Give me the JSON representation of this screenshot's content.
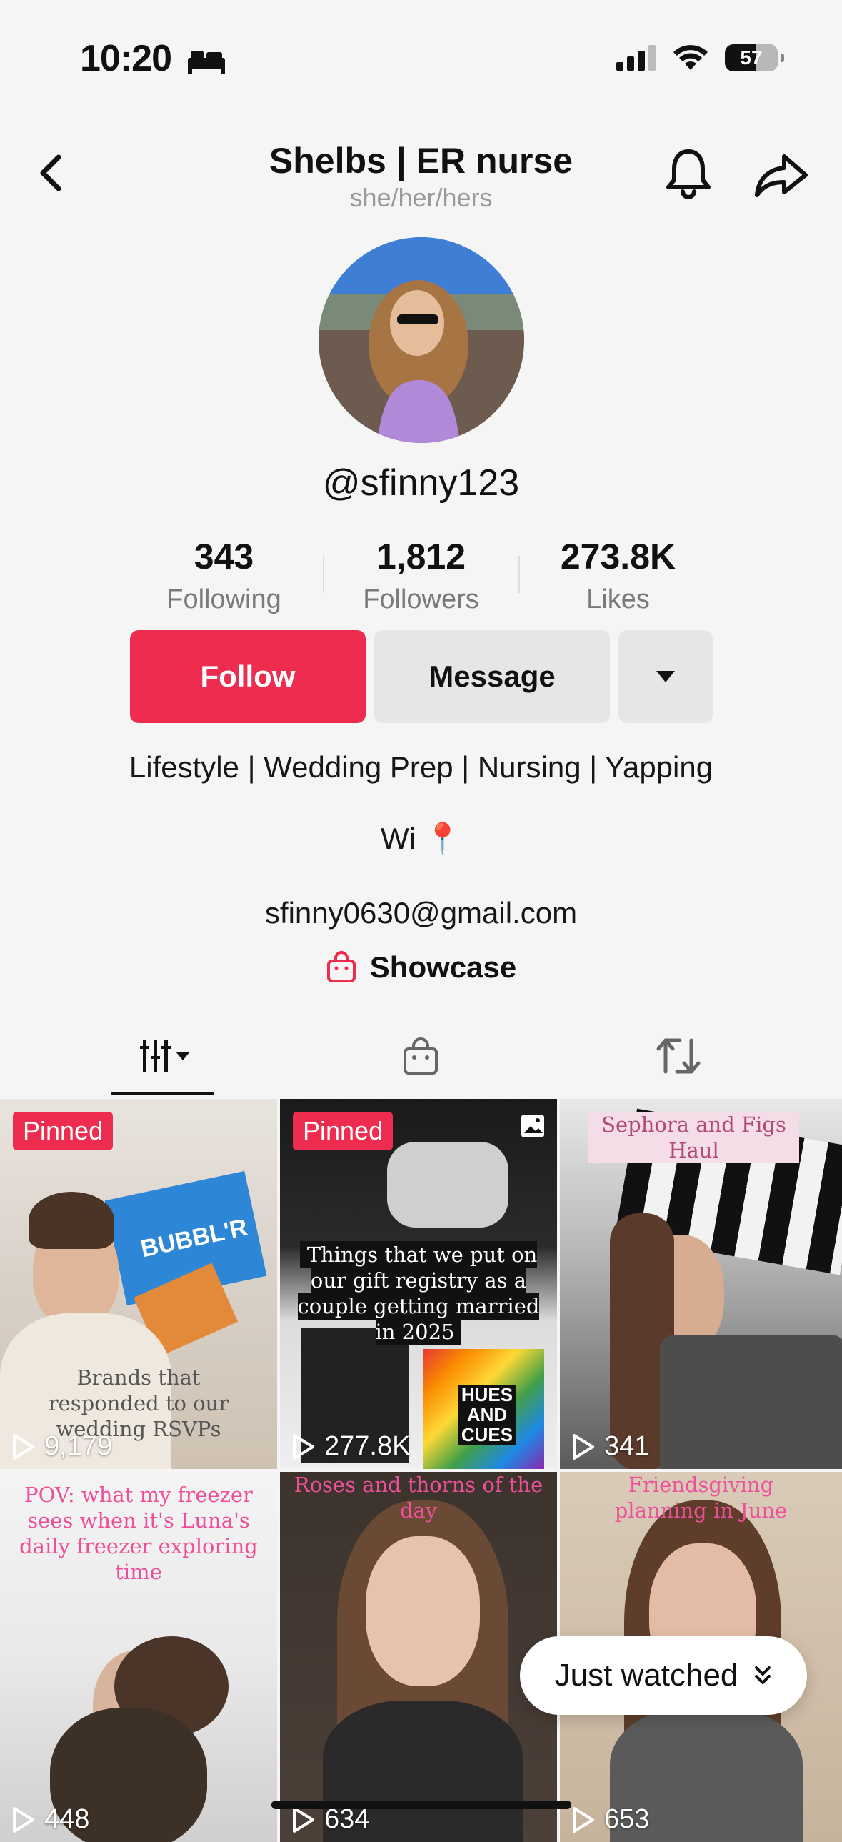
{
  "status_bar": {
    "time": "10:20",
    "battery": "57"
  },
  "header": {
    "title": "Shelbs | ER nurse",
    "pronouns": "she/her/hers"
  },
  "profile": {
    "username": "@sfinny123",
    "stats": [
      {
        "value": "343",
        "label": "Following"
      },
      {
        "value": "1,812",
        "label": "Followers"
      },
      {
        "value": "273.8K",
        "label": "Likes"
      }
    ],
    "follow_label": "Follow",
    "message_label": "Message",
    "bio_line1": "Lifestyle | Wedding Prep | Nursing | Yapping",
    "bio_line2": "Wi 📍",
    "email": "sfinny0630@gmail.com",
    "showcase_label": "Showcase"
  },
  "colors": {
    "accent": "#ee2c50",
    "secondary_button": "#e6e6e6",
    "background": "#f5f5f5"
  },
  "tabs": [
    {
      "icon": "videos-grid-icon",
      "active": true
    },
    {
      "icon": "shop-bag-icon",
      "active": false
    },
    {
      "icon": "repost-icon",
      "active": false
    }
  ],
  "videos": [
    {
      "pinned": "Pinned",
      "views": "9,179",
      "caption": "Brands that responded to our wedding RSVPs",
      "overlay_text": "BUBBL'R"
    },
    {
      "pinned": "Pinned",
      "views": "277.8K",
      "caption": "Things that we put on our gift registry as a couple getting married in 2025",
      "overlay_text": "HUES AND CUES"
    },
    {
      "pinned": "",
      "views": "341",
      "caption": "Sephora and Figs Haul"
    },
    {
      "pinned": "",
      "views": "448",
      "caption": "POV: what my freezer sees when it's Luna's daily freezer exploring time"
    },
    {
      "pinned": "",
      "views": "634",
      "caption": "Roses and thorns of the day"
    },
    {
      "pinned": "",
      "views": "653",
      "caption": "Friendsgiving planning in June"
    }
  ],
  "just_watched_label": "Just watched"
}
